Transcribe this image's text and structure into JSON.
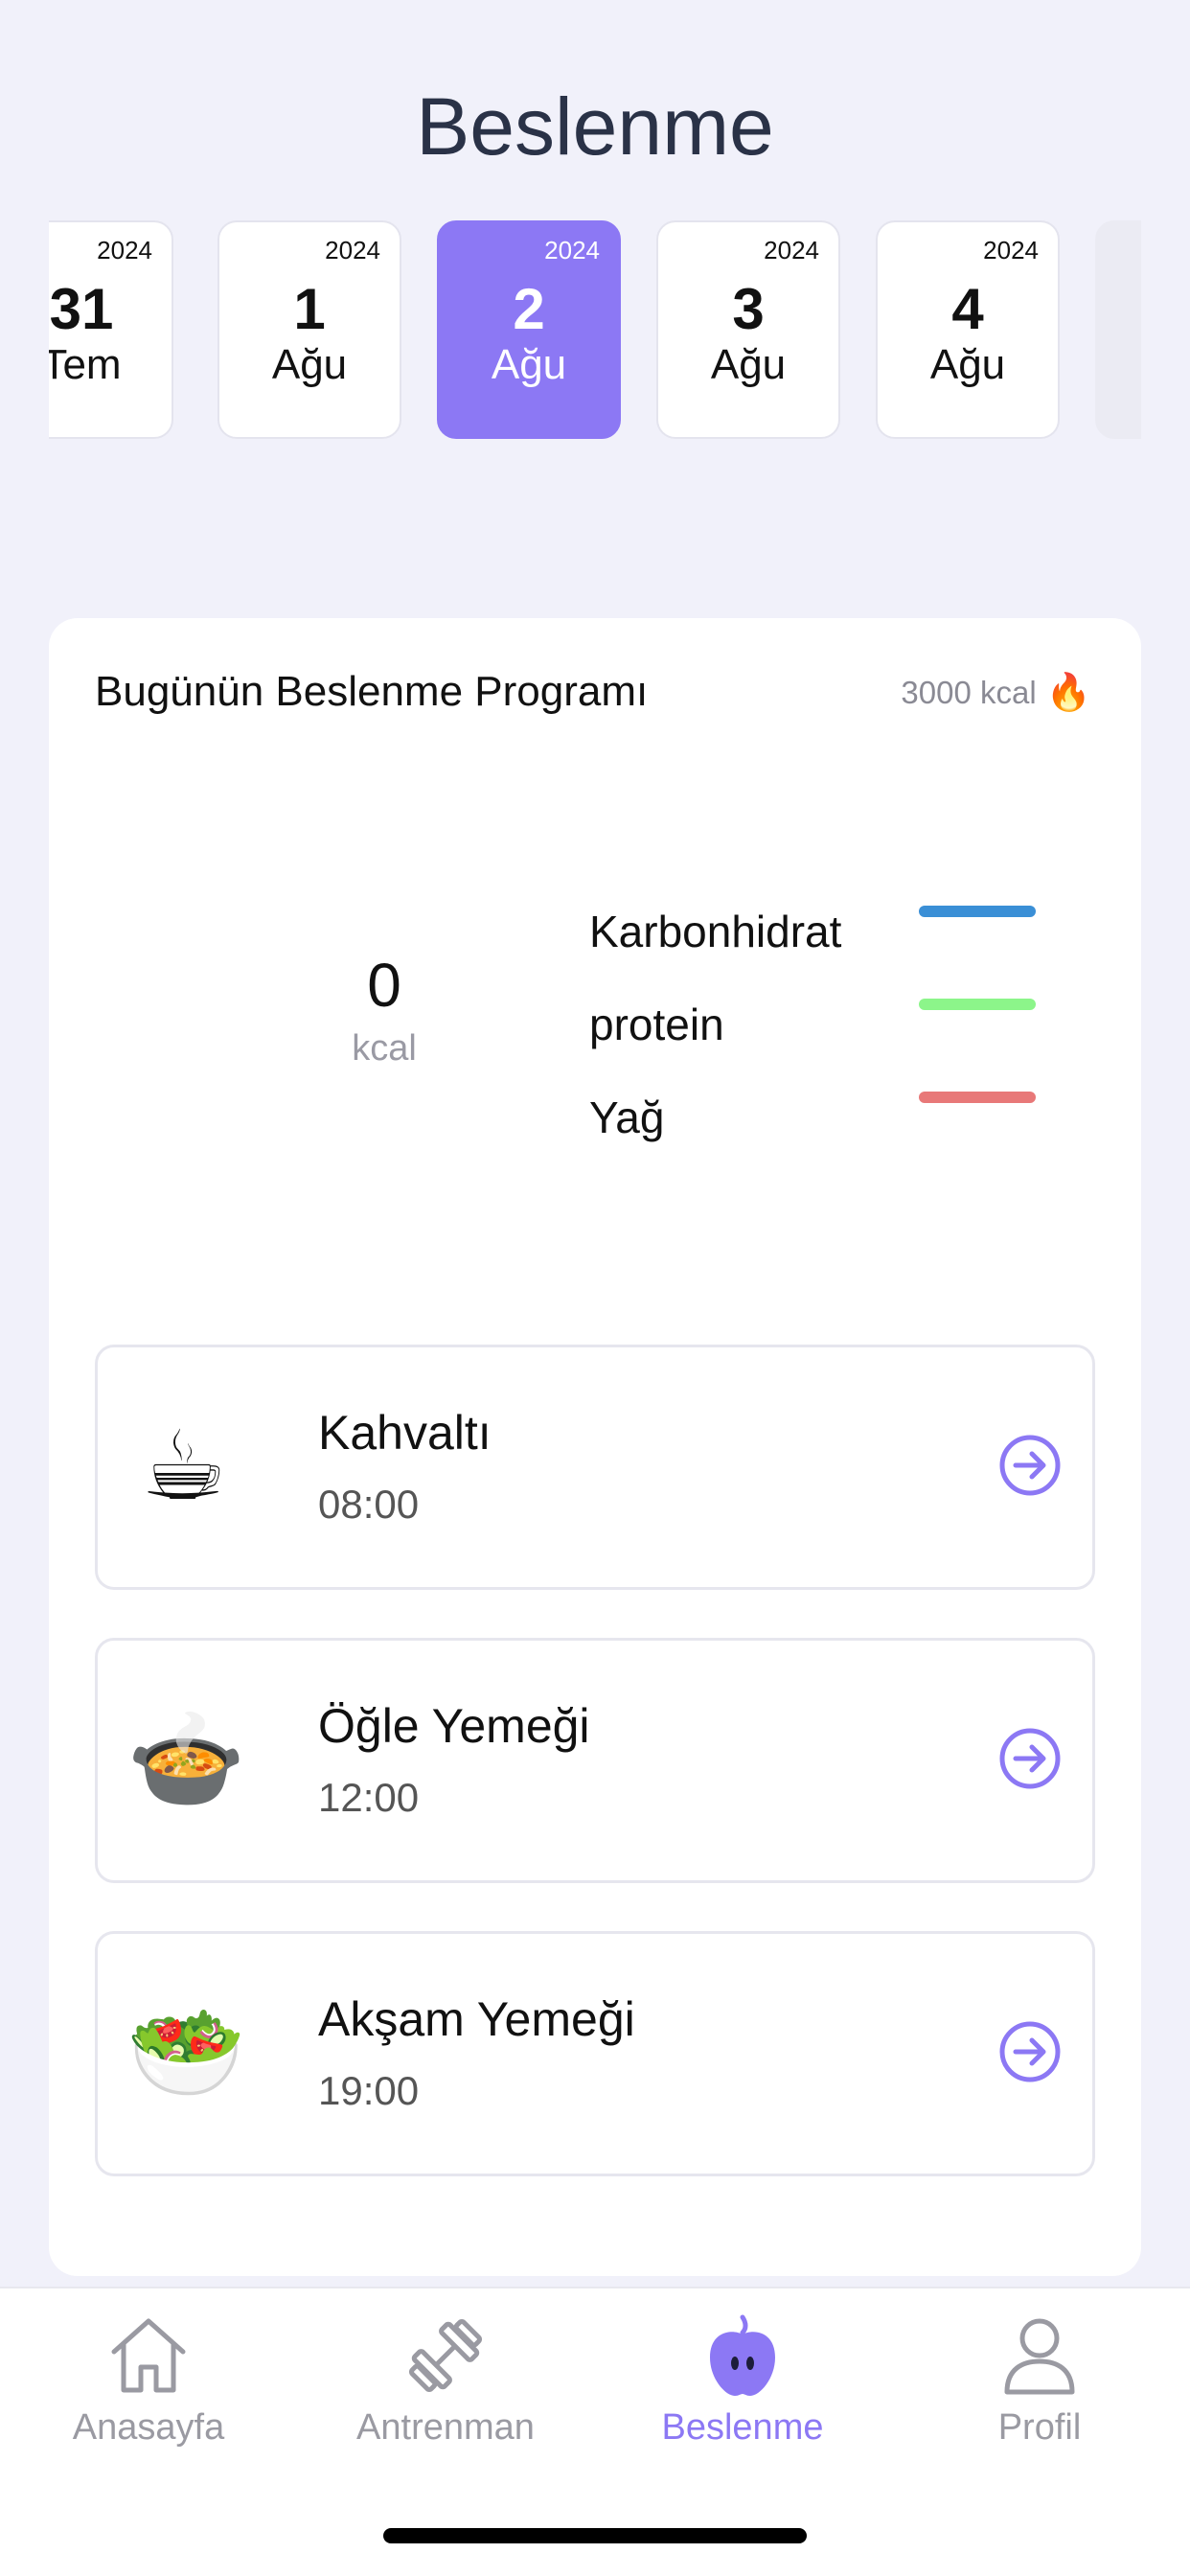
{
  "header": {
    "title": "Beslenme"
  },
  "dates": [
    {
      "year": "2024",
      "day": "31",
      "month": "Tem"
    },
    {
      "year": "2024",
      "day": "1",
      "month": "Ağu"
    },
    {
      "year": "2024",
      "day": "2",
      "month": "Ağu",
      "selected": true
    },
    {
      "year": "2024",
      "day": "3",
      "month": "Ağu"
    },
    {
      "year": "2024",
      "day": "4",
      "month": "Ağu"
    }
  ],
  "program": {
    "title": "Bugünün Beslenme Programı",
    "target_kcal": "3000 kcal",
    "flame_icon": "fire-icon",
    "consumed_value": "0",
    "consumed_unit": "kcal",
    "macros": [
      {
        "label": "Karbonhidrat",
        "color": "#3a8fd6"
      },
      {
        "label": "protein",
        "color": "#8cf58a"
      },
      {
        "label": "Yağ",
        "color": "#e87878"
      }
    ]
  },
  "meals": [
    {
      "title": "Kahvaltı",
      "time": "08:00",
      "emoji": "☕",
      "icon": "coffee-icon"
    },
    {
      "title": "Öğle Yemeği",
      "time": "12:00",
      "emoji": "🍲",
      "icon": "soup-icon"
    },
    {
      "title": "Akşam Yemeği",
      "time": "19:00",
      "emoji": "🥗",
      "icon": "salad-icon"
    }
  ],
  "colors": {
    "accent": "#8c78f4",
    "background": "#f1f1fa"
  },
  "tabs": [
    {
      "label": "Anasayfa",
      "icon": "home-icon"
    },
    {
      "label": "Antrenman",
      "icon": "dumbbell-icon"
    },
    {
      "label": "Beslenme",
      "icon": "apple-icon",
      "active": true
    },
    {
      "label": "Profil",
      "icon": "profile-icon"
    }
  ]
}
